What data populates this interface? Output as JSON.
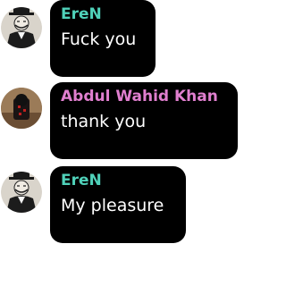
{
  "messages": [
    {
      "author": "EreN",
      "author_color": "#4fd1b9",
      "text": "Fuck you",
      "avatar": "gentleman-hat-avatar"
    },
    {
      "author": "Abdul Wahid Khan",
      "author_color": "#e07fcf",
      "text": "thank you",
      "avatar": "dark-figure-avatar"
    },
    {
      "author": "EreN",
      "author_color": "#4fd1b9",
      "text": "My pleasure",
      "avatar": "gentleman-hat-avatar"
    }
  ],
  "colors": {
    "bubble": "#000000",
    "message_text": "#ffffff",
    "background": "#ffffff"
  }
}
